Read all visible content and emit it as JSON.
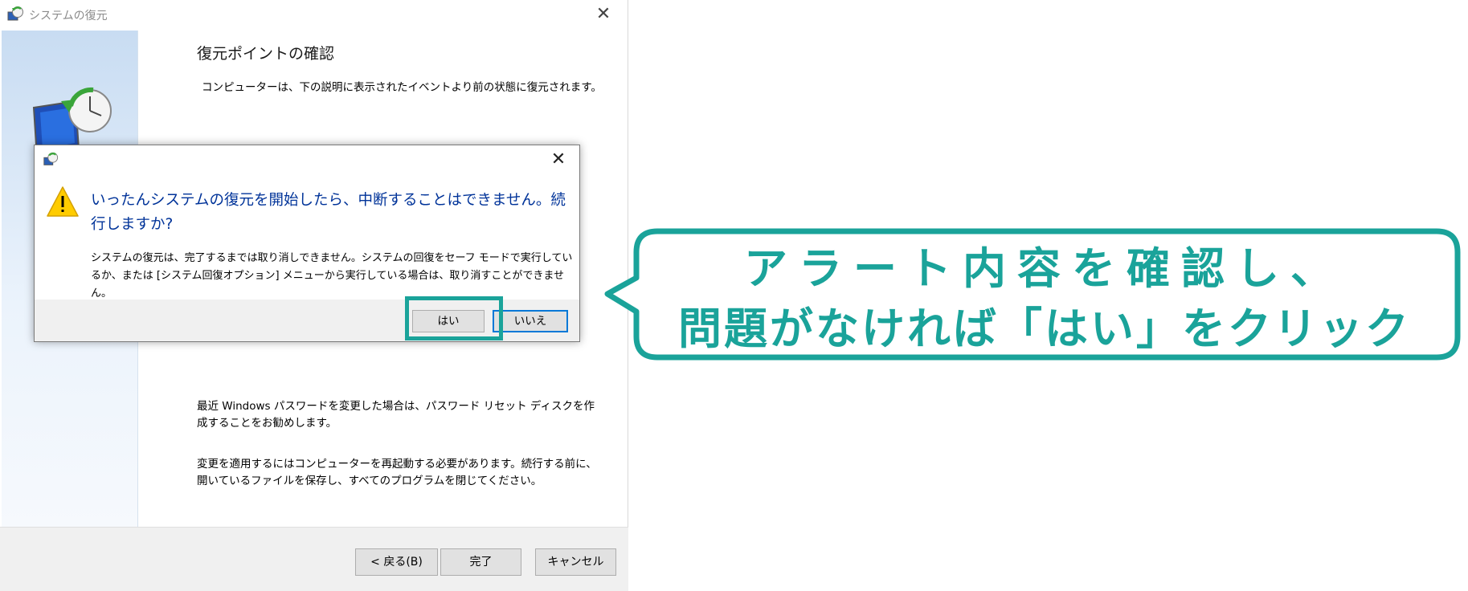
{
  "window": {
    "title": "システムの復元",
    "heading": "復元ポイントの確認",
    "subtitle": "コンピューターは、下の説明に表示されたイベントより前の状態に復元されます。",
    "password_note": "最近 Windows パスワードを変更した場合は、パスワード リセット ディスクを作成することをお勧めします。",
    "restart_note": "変更を適用するにはコンピューターを再起動する必要があります。続行する前に、開いているファイルを保存し、すべてのプログラムを閉じてください。",
    "buttons": {
      "back": "< 戻る(B)",
      "finish": "完了",
      "cancel": "キャンセル"
    },
    "close_glyph": "✕"
  },
  "dialog": {
    "main_instruction": "いったんシステムの復元を開始したら、中断することはできません。続行しますか?",
    "detail": "システムの復元は、完了するまでは取り消しできません。システムの回復をセーフ モードで実行しているか、または [システム回復オプション] メニューから実行している場合は、取り消すことができません。",
    "buttons": {
      "yes": "はい",
      "no": "いいえ"
    },
    "close_glyph": "✕"
  },
  "annotation": {
    "line1": "アラート内容を確認し、",
    "line2": "問題がなければ「はい」をクリック",
    "color": "#1aa39a"
  }
}
